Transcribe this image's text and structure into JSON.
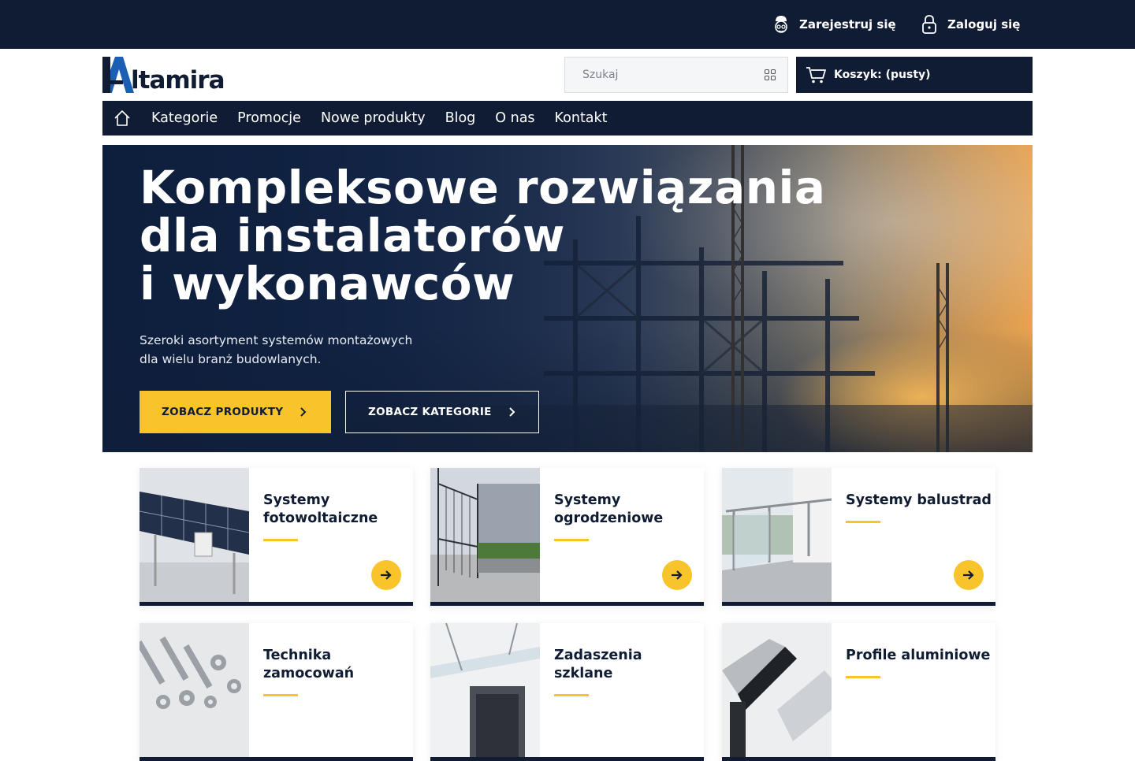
{
  "topbar": {
    "register_label": "Zarejestruj się",
    "login_label": "Zaloguj się"
  },
  "header": {
    "logo_text": "ltamira",
    "search_placeholder": "Szukaj",
    "cart_label": "Koszyk: (pusty)"
  },
  "nav": {
    "items": [
      "Kategorie",
      "Promocje",
      "Nowe produkty",
      "Blog",
      "O nas",
      "Kontakt"
    ]
  },
  "hero": {
    "title_line1": "Kompleksowe rozwiązania",
    "title_line2": "dla instalatorów",
    "title_line3": "i wykonawców",
    "subtitle_line1": "Szeroki asortyment systemów montażowych",
    "subtitle_line2": "dla wielu branż budowlanych.",
    "primary_button": "ZOBACZ PRODUKTY",
    "secondary_button": "ZOBACZ KATEGORIE"
  },
  "categories": [
    {
      "title": "Systemy fotowoltaiczne",
      "image": "solar-panels"
    },
    {
      "title": "Systemy ogrodzeniowe",
      "image": "fence-panels"
    },
    {
      "title": "Systemy balustrad",
      "image": "glass-balustrade"
    },
    {
      "title": "Technika zamocowań",
      "image": "fasteners"
    },
    {
      "title": "Zadaszenia szklane",
      "image": "glass-canopy"
    },
    {
      "title": "Profile aluminiowe",
      "image": "aluminium-profiles"
    }
  ],
  "colors": {
    "navy": "#0f1c33",
    "accent_yellow": "#f8c42a",
    "logo_blue": "#1a5fb4"
  },
  "icons": {
    "register": "user-helmet-icon",
    "login": "lock-icon",
    "search": "search-grid-icon",
    "cart": "cart-icon",
    "home": "home-icon",
    "chevron": "chevron-right-icon",
    "arrow": "arrow-right-icon"
  }
}
